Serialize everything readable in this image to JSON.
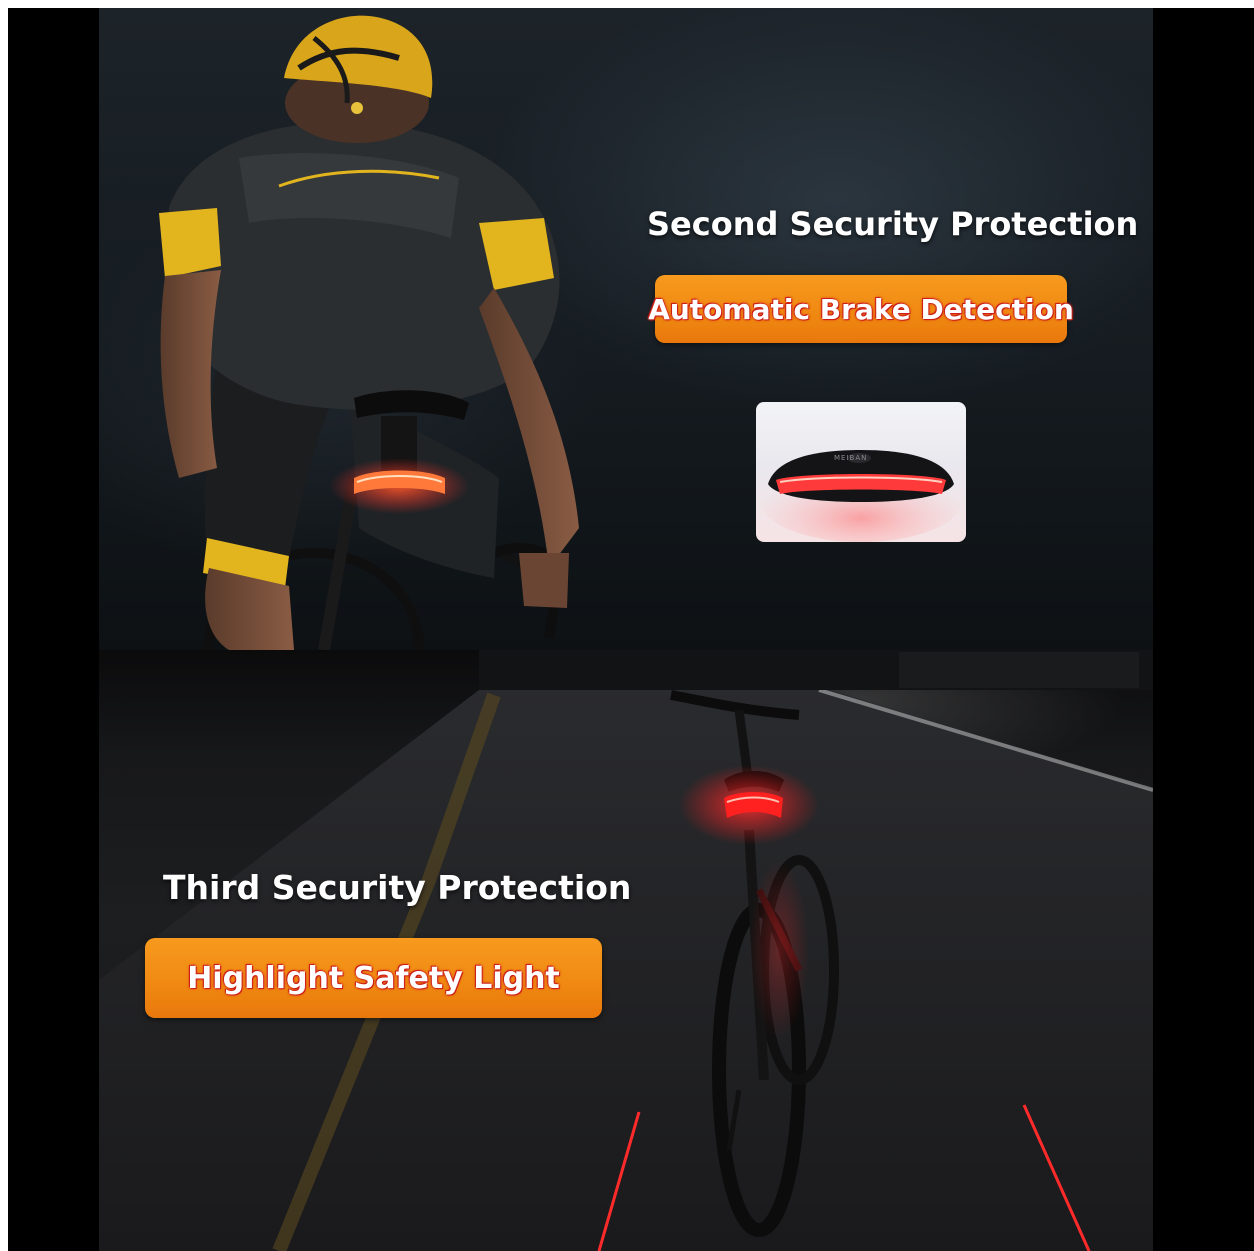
{
  "top_section": {
    "heading": "Second Security Protection",
    "feature_label": "Automatic Brake Detection",
    "product_brand_mark": "MEIBAN"
  },
  "bottom_section": {
    "heading": "Third Security Protection",
    "feature_label": "Highlight Safety Light"
  },
  "colors": {
    "badge_orange": "#f08a12",
    "text_outline_red": "#d0201a",
    "tail_light_red": "#ff2a2a",
    "jersey_yellow": "#e2b51f"
  }
}
